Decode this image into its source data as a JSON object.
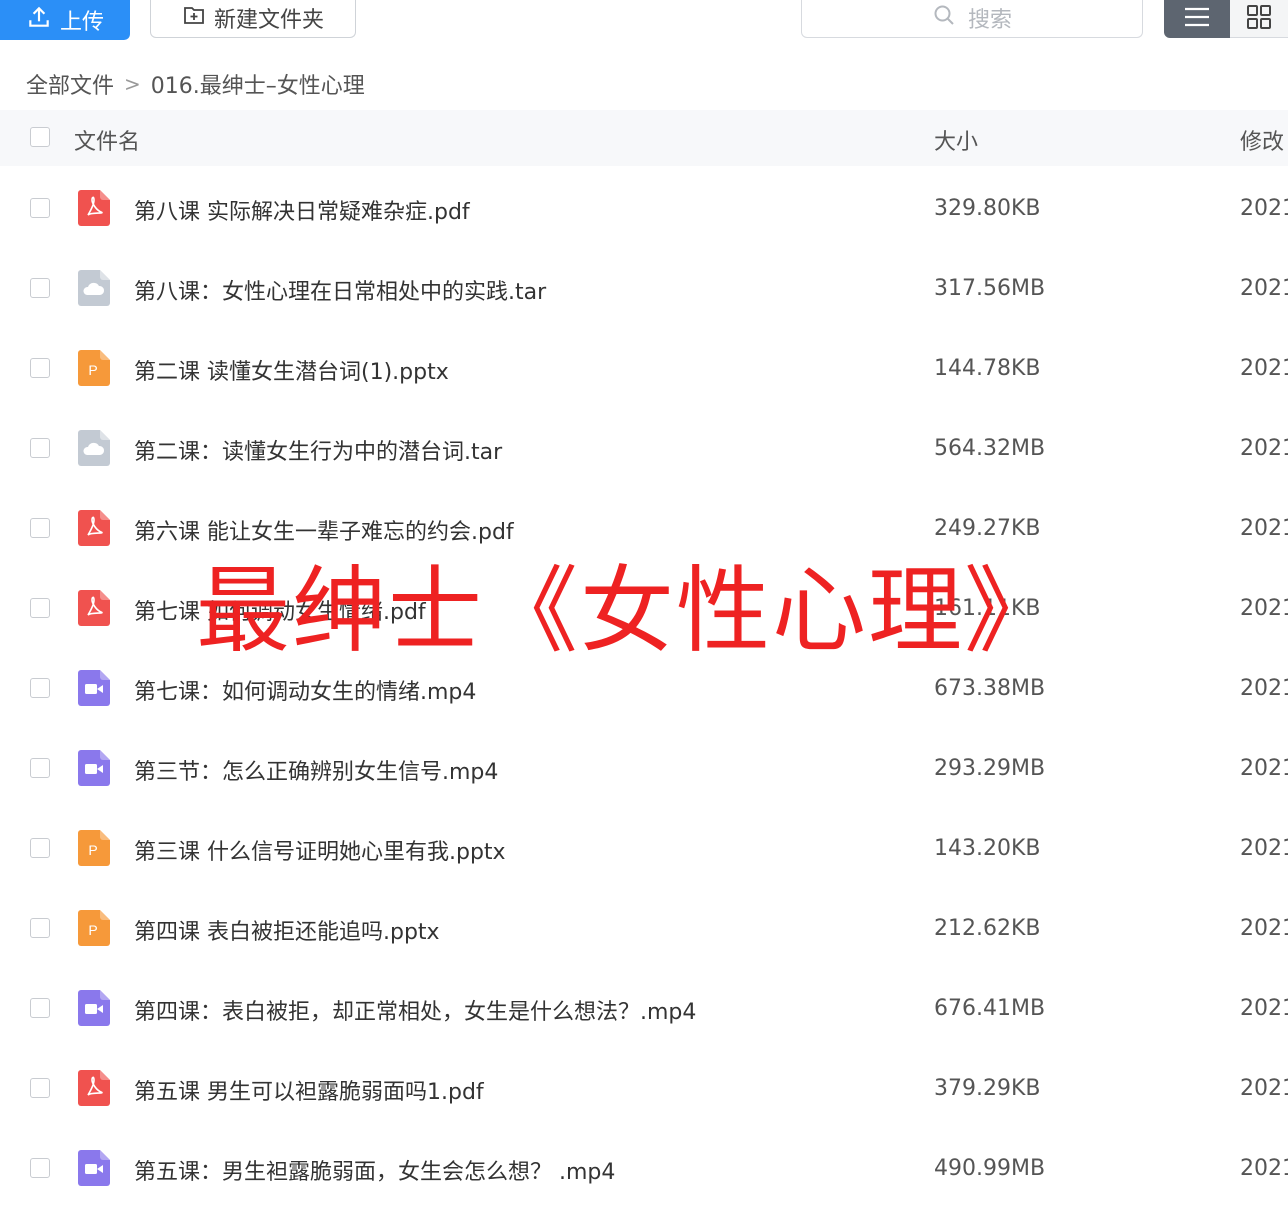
{
  "toolbar": {
    "upload_label": "上传",
    "newfolder_label": "新建文件夹",
    "search_placeholder": "搜索"
  },
  "breadcrumb": {
    "root": "全部文件",
    "separator": ">",
    "current": "016.最绅士–女性心理"
  },
  "columns": {
    "name": "文件名",
    "size": "大小",
    "modified": "修改"
  },
  "colors": {
    "pdf": "#f0524f",
    "tar": "#c3cad3",
    "pptx": "#f6993a",
    "mp4": "#8a78ec",
    "accent": "#2b8ff7",
    "watermark": "#ee2222"
  },
  "files": [
    {
      "name": "第八课 实际解决日常疑难杂症.pdf",
      "size": "329.80KB",
      "date": "2021",
      "type": "pdf"
    },
    {
      "name": "第八课：女性心理在日常相处中的实践.tar",
      "size": "317.56MB",
      "date": "2021",
      "type": "tar"
    },
    {
      "name": "第二课 读懂女生潜台词(1).pptx",
      "size": "144.78KB",
      "date": "2021",
      "type": "pptx"
    },
    {
      "name": "第二课：读懂女生行为中的潜台词.tar",
      "size": "564.32MB",
      "date": "2021",
      "type": "tar"
    },
    {
      "name": "第六课 能让女生一辈子难忘的约会.pdf",
      "size": "249.27KB",
      "date": "2021",
      "type": "pdf"
    },
    {
      "name": "第七课 如何调动女生情绪.pdf",
      "size": "161.11KB",
      "date": "2021",
      "type": "pdf"
    },
    {
      "name": "第七课：如何调动女生的情绪.mp4",
      "size": "673.38MB",
      "date": "2021",
      "type": "mp4"
    },
    {
      "name": "第三节：怎么正确辨别女生信号.mp4",
      "size": "293.29MB",
      "date": "2021",
      "type": "mp4"
    },
    {
      "name": "第三课 什么信号证明她心里有我.pptx",
      "size": "143.20KB",
      "date": "2021",
      "type": "pptx"
    },
    {
      "name": "第四课 表白被拒还能追吗.pptx",
      "size": "212.62KB",
      "date": "2021",
      "type": "pptx"
    },
    {
      "name": "第四课：表白被拒，却正常相处，女生是什么想法？.mp4",
      "size": "676.41MB",
      "date": "2021",
      "type": "mp4"
    },
    {
      "name": "第五课 男生可以袒露脆弱面吗1.pdf",
      "size": "379.29KB",
      "date": "2021",
      "type": "pdf"
    },
    {
      "name": "第五课：男生袒露脆弱面，女生会怎么想？ .mp4",
      "size": "490.99MB",
      "date": "2021",
      "type": "mp4"
    }
  ],
  "watermark": "最绅士《女性心理》"
}
